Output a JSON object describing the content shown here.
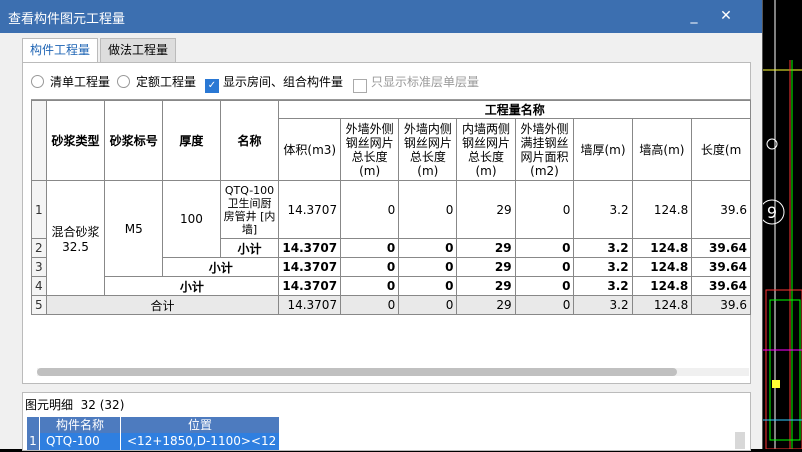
{
  "window": {
    "title": "查看构件图元工程量",
    "minimize": "_",
    "close": "✕"
  },
  "tabs": [
    {
      "label": "构件工程量",
      "active": true
    },
    {
      "label": "做法工程量",
      "active": false
    }
  ],
  "options": {
    "qingdan": "清单工程量",
    "dinge": "定额工程量",
    "show_rooms": "显示房间、组合构件量",
    "only_std": "只显示标准层单层量"
  },
  "table": {
    "group_header": "工程量名称",
    "fixed_headers": [
      "砂浆类型",
      "砂浆标号",
      "厚度",
      "名称"
    ],
    "qty_headers": [
      "体积(m3)",
      "外墙外侧钢丝网片总长度(m)",
      "外墙内侧钢丝网片总长度(m)",
      "内墙两侧钢丝网片总长度(m)",
      "外墙外侧满挂钢丝网片面积(m2)",
      "墙厚(m)",
      "墙高(m)",
      "长度(m"
    ],
    "row_nums": [
      "1",
      "2",
      "3",
      "4",
      "5"
    ],
    "mortar_type": "混合砂浆32.5",
    "mortar_grade": "M5",
    "thickness": "100",
    "name": "QTQ-100卫生间厨房管井 [内墙]",
    "subtotal_label": "小计",
    "total_label": "合计",
    "rows": [
      [
        "14.3707",
        "0",
        "0",
        "29",
        "0",
        "3.2",
        "124.8",
        "39.6"
      ],
      [
        "14.3707",
        "0",
        "0",
        "29",
        "0",
        "3.2",
        "124.8",
        "39.64"
      ],
      [
        "14.3707",
        "0",
        "0",
        "29",
        "0",
        "3.2",
        "124.8",
        "39.64"
      ],
      [
        "14.3707",
        "0",
        "0",
        "29",
        "0",
        "3.2",
        "124.8",
        "39.64"
      ],
      [
        "14.3707",
        "0",
        "0",
        "29",
        "0",
        "3.2",
        "124.8",
        "39.6"
      ]
    ]
  },
  "detail": {
    "label": "图元明细",
    "count": "32 (32)",
    "headers": [
      "构件名称",
      "位置"
    ],
    "row": {
      "num": "1",
      "name": "QTQ-100",
      "pos": "<12+1850,D-1100><12"
    }
  }
}
